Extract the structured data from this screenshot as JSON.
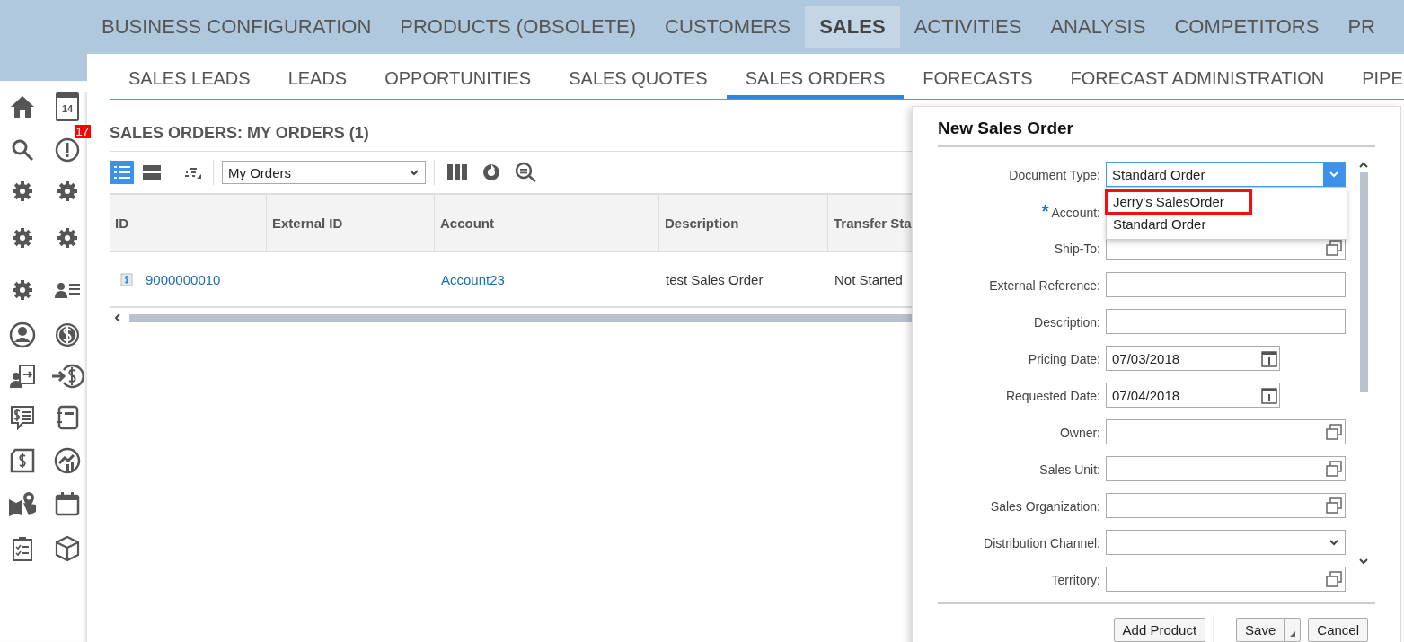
{
  "top_nav": [
    {
      "label": "BUSINESS CONFIGURATION",
      "selected": false
    },
    {
      "label": "PRODUCTS (OBSOLETE)",
      "selected": false
    },
    {
      "label": "CUSTOMERS",
      "selected": false
    },
    {
      "label": "SALES",
      "selected": true
    },
    {
      "label": "ACTIVITIES",
      "selected": false
    },
    {
      "label": "ANALYSIS",
      "selected": false
    },
    {
      "label": "COMPETITORS",
      "selected": false
    },
    {
      "label": "PR",
      "selected": false
    }
  ],
  "sidebar": {
    "calendar_day": "14",
    "badge": "17"
  },
  "sub_nav": [
    {
      "label": "SALES LEADS",
      "selected": false
    },
    {
      "label": "LEADS",
      "selected": false
    },
    {
      "label": "OPPORTUNITIES",
      "selected": false
    },
    {
      "label": "SALES QUOTES",
      "selected": false
    },
    {
      "label": "SALES ORDERS",
      "selected": true
    },
    {
      "label": "FORECASTS",
      "selected": false
    },
    {
      "label": "FORECAST ADMINISTRATION",
      "selected": false
    },
    {
      "label": "PIPE",
      "selected": false
    }
  ],
  "page_title": "SALES ORDERS: MY ORDERS (1)",
  "toolbar": {
    "view_select": "My Orders"
  },
  "table": {
    "columns": [
      "ID",
      "External ID",
      "Account",
      "Description",
      "Transfer Sta"
    ],
    "rows": [
      {
        "id": "9000000010",
        "external_id": "",
        "account": "Account23",
        "description": "test Sales Order",
        "status": "Not Started"
      }
    ]
  },
  "dialog": {
    "title": "New Sales Order",
    "fields": [
      {
        "label": "Document Type:",
        "kind": "select",
        "value": "Standard Order",
        "open": true,
        "options": [
          {
            "label": "Jerry's SalesOrder",
            "highlighted": true
          },
          {
            "label": "Standard Order",
            "highlighted": false
          }
        ]
      },
      {
        "label": "Account:",
        "kind": "hidden",
        "required_mark": "*"
      },
      {
        "label": "Ship-To:",
        "kind": "lookup"
      },
      {
        "label": "External Reference:",
        "kind": "text"
      },
      {
        "label": "Description:",
        "kind": "text"
      },
      {
        "label": "Pricing Date:",
        "kind": "date",
        "value": "07/03/2018"
      },
      {
        "label": "Requested Date:",
        "kind": "date",
        "value": "07/04/2018"
      },
      {
        "label": "Owner:",
        "kind": "lookup"
      },
      {
        "label": "Sales Unit:",
        "kind": "lookup"
      },
      {
        "label": "Sales Organization:",
        "kind": "lookup"
      },
      {
        "label": "Distribution Channel:",
        "kind": "select",
        "open": false
      },
      {
        "label": "Territory:",
        "kind": "lookup"
      }
    ],
    "buttons": [
      {
        "label": "Add Product",
        "kind": "plain"
      },
      {
        "label": "Save",
        "kind": "split"
      },
      {
        "label": "Cancel",
        "kind": "plain"
      }
    ]
  }
}
